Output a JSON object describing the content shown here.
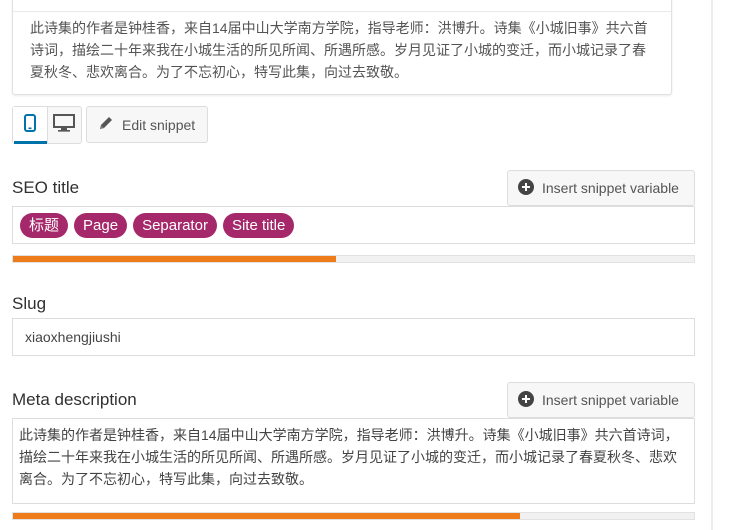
{
  "preview": {
    "description": "此诗集的作者是钟桂香，来自14届中山大学南方学院，指导老师：洪博升。诗集《小城旧事》共六首诗词，描绘二十年来我在小城生活的所见所闻、所遇所感。岁月见证了小城的变迁，而小城记录了春夏秋冬、悲欢离合。为了不忘初心，特写此集，向过去致敬。"
  },
  "toolbar": {
    "edit_snippet_label": "Edit snippet",
    "mobile_icon": "mobile-icon",
    "desktop_icon": "desktop-icon",
    "accent_color": "#0073aa"
  },
  "seo_title": {
    "label": "SEO title",
    "insert_label": "Insert snippet variable",
    "tags": [
      "标题",
      "Page",
      "Separator",
      "Site title"
    ],
    "tag_color": "#a4286a",
    "progress_fraction": 0.475,
    "progress_color": "#ee7c1b"
  },
  "slug": {
    "label": "Slug",
    "value": "xiaoxhengjiushi"
  },
  "meta_description": {
    "label": "Meta description",
    "insert_label": "Insert snippet variable",
    "value": "此诗集的作者是钟桂香，来自14届中山大学南方学院，指导老师：洪博升。诗集《小城旧事》共六首诗词，描绘二十年来我在小城生活的所见所闻、所遇所感。岁月见证了小城的变迁，而小城记录了春夏秋冬、悲欢离合。为了不忘初心，特写此集，向过去致敬。",
    "progress_fraction": 0.745,
    "progress_color": "#ee7c1b"
  }
}
